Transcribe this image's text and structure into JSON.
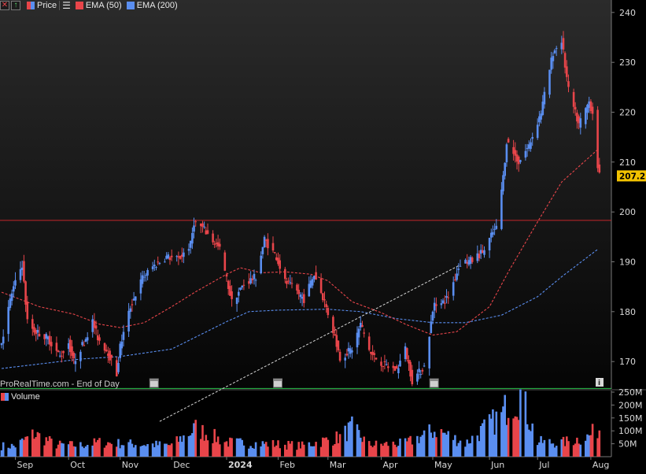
{
  "legend": {
    "price_label": "Price",
    "ema50_label": "EMA (50)",
    "ema200_label": "EMA (200)",
    "volume_label": "Volume"
  },
  "footer": {
    "source_label": "ProRealTime.com - End of Day"
  },
  "colors": {
    "up": "#5a8ef0",
    "down": "#e8454a",
    "ema50": "#e8454a",
    "ema200": "#5a8ef0",
    "trendline": "#d8d8d8",
    "resistance": "#c4262b",
    "support": "#29c24a",
    "price_badge": "#f2c200",
    "axis_text": "#d8d8d8"
  },
  "icons": [
    "close-icon",
    "up-arrow-icon",
    "menu-icon",
    "calendar-icon",
    "info-icon"
  ],
  "chart_data": {
    "type": "candlestick",
    "price_axis": {
      "ticks": [
        170,
        180,
        190,
        200,
        210,
        220,
        230,
        240
      ],
      "range": [
        164.5,
        242.5
      ],
      "scale": "linear"
    },
    "volume_axis": {
      "ticks": [
        "50M",
        "100M",
        "150M",
        "200M",
        "250M"
      ],
      "tick_values": [
        50,
        100,
        150,
        200,
        250
      ],
      "unit": "shares (millions)",
      "range": [
        0,
        250
      ]
    },
    "x_axis": {
      "labels": [
        "Sep",
        "Oct",
        "Nov",
        "Dec",
        "2024",
        "Feb",
        "Mar",
        "Apr",
        "May",
        "Jun",
        "Jul",
        "Aug"
      ],
      "label_dates": [
        "2023-09-01",
        "2023-10-02",
        "2023-11-01",
        "2023-12-01",
        "2024-01-02",
        "2024-02-01",
        "2024-03-01",
        "2024-04-01",
        "2024-05-01",
        "2024-06-03",
        "2024-07-01",
        "2024-08-01"
      ],
      "range": [
        "2023-08-24",
        "2024-08-07"
      ]
    },
    "last_price": {
      "value": 207.23,
      "label": "207.23"
    },
    "horizontal_lines": [
      {
        "name": "resistance",
        "value": 198.3
      },
      {
        "name": "support",
        "value": 164.6
      }
    ],
    "trendline": {
      "from": {
        "date": "2023-11-24",
        "value": 158.0
      },
      "to": {
        "date": "2024-05-17",
        "value": 189.4
      },
      "style": "dashed"
    },
    "ema50": [
      [
        "2023-08-24",
        183.9
      ],
      [
        "2023-09-15",
        181.0
      ],
      [
        "2023-10-05",
        179.5
      ],
      [
        "2023-10-20",
        177.5
      ],
      [
        "2023-11-01",
        176.8
      ],
      [
        "2023-11-15",
        177.8
      ],
      [
        "2023-12-01",
        181.0
      ],
      [
        "2023-12-15",
        184.0
      ],
      [
        "2024-01-02",
        187.5
      ],
      [
        "2024-01-10",
        188.8
      ],
      [
        "2024-01-22",
        187.8
      ],
      [
        "2024-02-05",
        188.0
      ],
      [
        "2024-02-20",
        187.5
      ],
      [
        "2024-03-01",
        186.2
      ],
      [
        "2024-03-15",
        182.0
      ],
      [
        "2024-04-01",
        179.8
      ],
      [
        "2024-04-15",
        177.5
      ],
      [
        "2024-05-01",
        175.3
      ],
      [
        "2024-05-15",
        176.0
      ],
      [
        "2024-06-03",
        181.0
      ],
      [
        "2024-06-14",
        188.0
      ],
      [
        "2024-07-01",
        198.0
      ],
      [
        "2024-07-15",
        206.0
      ],
      [
        "2024-08-05",
        212.5
      ]
    ],
    "ema200": [
      [
        "2023-08-24",
        168.6
      ],
      [
        "2023-09-15",
        169.5
      ],
      [
        "2023-10-09",
        170.5
      ],
      [
        "2023-11-01",
        171.0
      ],
      [
        "2023-12-01",
        172.5
      ],
      [
        "2024-01-02",
        178.0
      ],
      [
        "2024-01-15",
        180.0
      ],
      [
        "2024-02-01",
        180.3
      ],
      [
        "2024-03-01",
        180.5
      ],
      [
        "2024-03-20",
        180.0
      ],
      [
        "2024-04-10",
        178.6
      ],
      [
        "2024-05-01",
        177.8
      ],
      [
        "2024-05-20",
        177.8
      ],
      [
        "2024-06-10",
        179.3
      ],
      [
        "2024-07-01",
        183.0
      ],
      [
        "2024-07-15",
        187.0
      ],
      [
        "2024-08-05",
        192.5
      ]
    ],
    "price_path": [
      [
        "2023-08-24",
        174.0
      ],
      [
        "2023-08-30",
        183.8
      ],
      [
        "2023-09-05",
        189.5
      ],
      [
        "2023-09-08",
        178.0
      ],
      [
        "2023-09-12",
        176.2
      ],
      [
        "2023-09-20",
        174.7
      ],
      [
        "2023-09-27",
        171.0
      ],
      [
        "2023-10-02",
        173.8
      ],
      [
        "2023-10-05",
        170.0
      ],
      [
        "2023-10-11",
        174.0
      ],
      [
        "2023-10-16",
        178.0
      ],
      [
        "2023-10-19",
        174.8
      ],
      [
        "2023-10-25",
        171.8
      ],
      [
        "2023-10-30",
        167.5
      ],
      [
        "2023-11-01",
        173.0
      ],
      [
        "2023-11-07",
        181.0
      ],
      [
        "2023-11-14",
        186.8
      ],
      [
        "2023-11-20",
        189.0
      ],
      [
        "2023-11-28",
        191.0
      ],
      [
        "2023-12-05",
        190.5
      ],
      [
        "2023-12-12",
        193.5
      ],
      [
        "2023-12-14",
        198.0
      ],
      [
        "2023-12-19",
        196.8
      ],
      [
        "2023-12-29",
        192.5
      ],
      [
        "2024-01-05",
        182.0
      ],
      [
        "2024-01-12",
        185.5
      ],
      [
        "2024-01-19",
        187.0
      ],
      [
        "2024-01-24",
        194.5
      ],
      [
        "2024-01-31",
        191.0
      ],
      [
        "2024-02-05",
        186.0
      ],
      [
        "2024-02-12",
        184.0
      ],
      [
        "2024-02-16",
        182.5
      ],
      [
        "2024-02-22",
        187.5
      ],
      [
        "2024-02-28",
        182.0
      ],
      [
        "2024-03-05",
        175.0
      ],
      [
        "2024-03-08",
        170.7
      ],
      [
        "2024-03-15",
        172.6
      ],
      [
        "2024-03-20",
        177.5
      ],
      [
        "2024-03-26",
        171.5
      ],
      [
        "2024-04-03",
        169.2
      ],
      [
        "2024-04-10",
        168.3
      ],
      [
        "2024-04-15",
        172.5
      ],
      [
        "2024-04-19",
        166.2
      ],
      [
        "2024-04-26",
        169.0
      ],
      [
        "2024-05-02",
        182.0
      ],
      [
        "2024-05-06",
        181.5
      ],
      [
        "2024-05-10",
        183.0
      ],
      [
        "2024-05-17",
        189.8
      ],
      [
        "2024-05-24",
        190.3
      ],
      [
        "2024-05-31",
        192.3
      ],
      [
        "2024-06-05",
        195.9
      ],
      [
        "2024-06-07",
        196.7
      ],
      [
        "2024-06-11",
        207.0
      ],
      [
        "2024-06-13",
        214.2
      ],
      [
        "2024-06-20",
        210.0
      ],
      [
        "2024-06-26",
        213.3
      ],
      [
        "2024-07-03",
        220.0
      ],
      [
        "2024-07-10",
        232.0
      ],
      [
        "2024-07-15",
        234.4
      ],
      [
        "2024-07-19",
        224.3
      ],
      [
        "2024-07-25",
        217.5
      ],
      [
        "2024-07-31",
        222.1
      ],
      [
        "2024-08-02",
        219.9
      ],
      [
        "2024-08-05",
        209.3
      ],
      [
        "2024-08-06",
        207.23
      ]
    ],
    "volume_path": [
      [
        "2023-09-01",
        45
      ],
      [
        "2023-09-12",
        95
      ],
      [
        "2023-09-25",
        50
      ],
      [
        "2023-10-09",
        48
      ],
      [
        "2023-10-20",
        60
      ],
      [
        "2023-11-01",
        55
      ],
      [
        "2023-12-01",
        48
      ],
      [
        "2023-12-15",
        118
      ],
      [
        "2024-01-02",
        60
      ],
      [
        "2024-02-01",
        52
      ],
      [
        "2024-02-15",
        46
      ],
      [
        "2024-03-08",
        82
      ],
      [
        "2024-03-15",
        120
      ],
      [
        "2024-03-25",
        50
      ],
      [
        "2024-04-15",
        55
      ],
      [
        "2024-05-03",
        112
      ],
      [
        "2024-05-20",
        55
      ],
      [
        "2024-06-11",
        178
      ],
      [
        "2024-06-14",
        230
      ],
      [
        "2024-06-21",
        260
      ],
      [
        "2024-07-01",
        62
      ],
      [
        "2024-07-15",
        58
      ],
      [
        "2024-07-31",
        85
      ],
      [
        "2024-08-05",
        118
      ]
    ]
  }
}
